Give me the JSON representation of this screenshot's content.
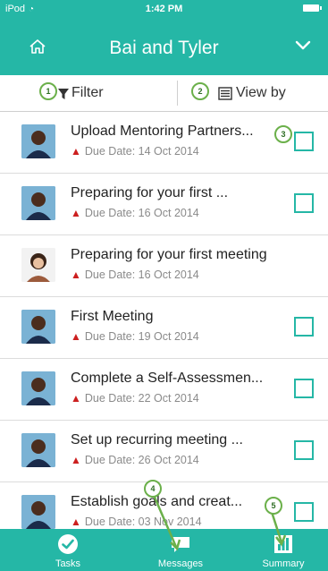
{
  "status": {
    "carrier": "iPod",
    "time": "1:42 PM"
  },
  "header": {
    "title": "Bai and Tyler"
  },
  "toolbar": {
    "filter_label": "Filter",
    "viewby_label": "View by"
  },
  "callouts": [
    "1",
    "2",
    "3",
    "4",
    "5"
  ],
  "tasks": [
    {
      "title": "Upload Mentoring Partners...",
      "due": "Due Date: 14 Oct 2014",
      "avatar": "male",
      "checkbox": true
    },
    {
      "title": "Preparing for your first ...",
      "due": "Due Date: 16 Oct 2014",
      "avatar": "male",
      "checkbox": true
    },
    {
      "title": "Preparing for your first meeting",
      "due": "Due Date: 16 Oct 2014",
      "avatar": "female",
      "checkbox": false
    },
    {
      "title": "First Meeting",
      "due": "Due Date: 19 Oct 2014",
      "avatar": "male",
      "checkbox": true
    },
    {
      "title": "Complete a Self-Assessmen...",
      "due": "Due Date: 22 Oct 2014",
      "avatar": "male",
      "checkbox": true
    },
    {
      "title": "Set up recurring meeting ...",
      "due": "Due Date: 26 Oct 2014",
      "avatar": "male",
      "checkbox": true
    },
    {
      "title": "Establish goals and creat...",
      "due": "Due Date: 03 Nov 2014",
      "avatar": "male",
      "checkbox": true
    }
  ],
  "tabs": [
    {
      "label": "Tasks",
      "icon": "check-circle-icon"
    },
    {
      "label": "Messages",
      "icon": "chat-bubble-icon"
    },
    {
      "label": "Summary",
      "icon": "summary-chart-icon"
    }
  ],
  "colors": {
    "accent": "#25b7a6",
    "callout": "#6bb04a",
    "warning": "#cc1f1f"
  }
}
